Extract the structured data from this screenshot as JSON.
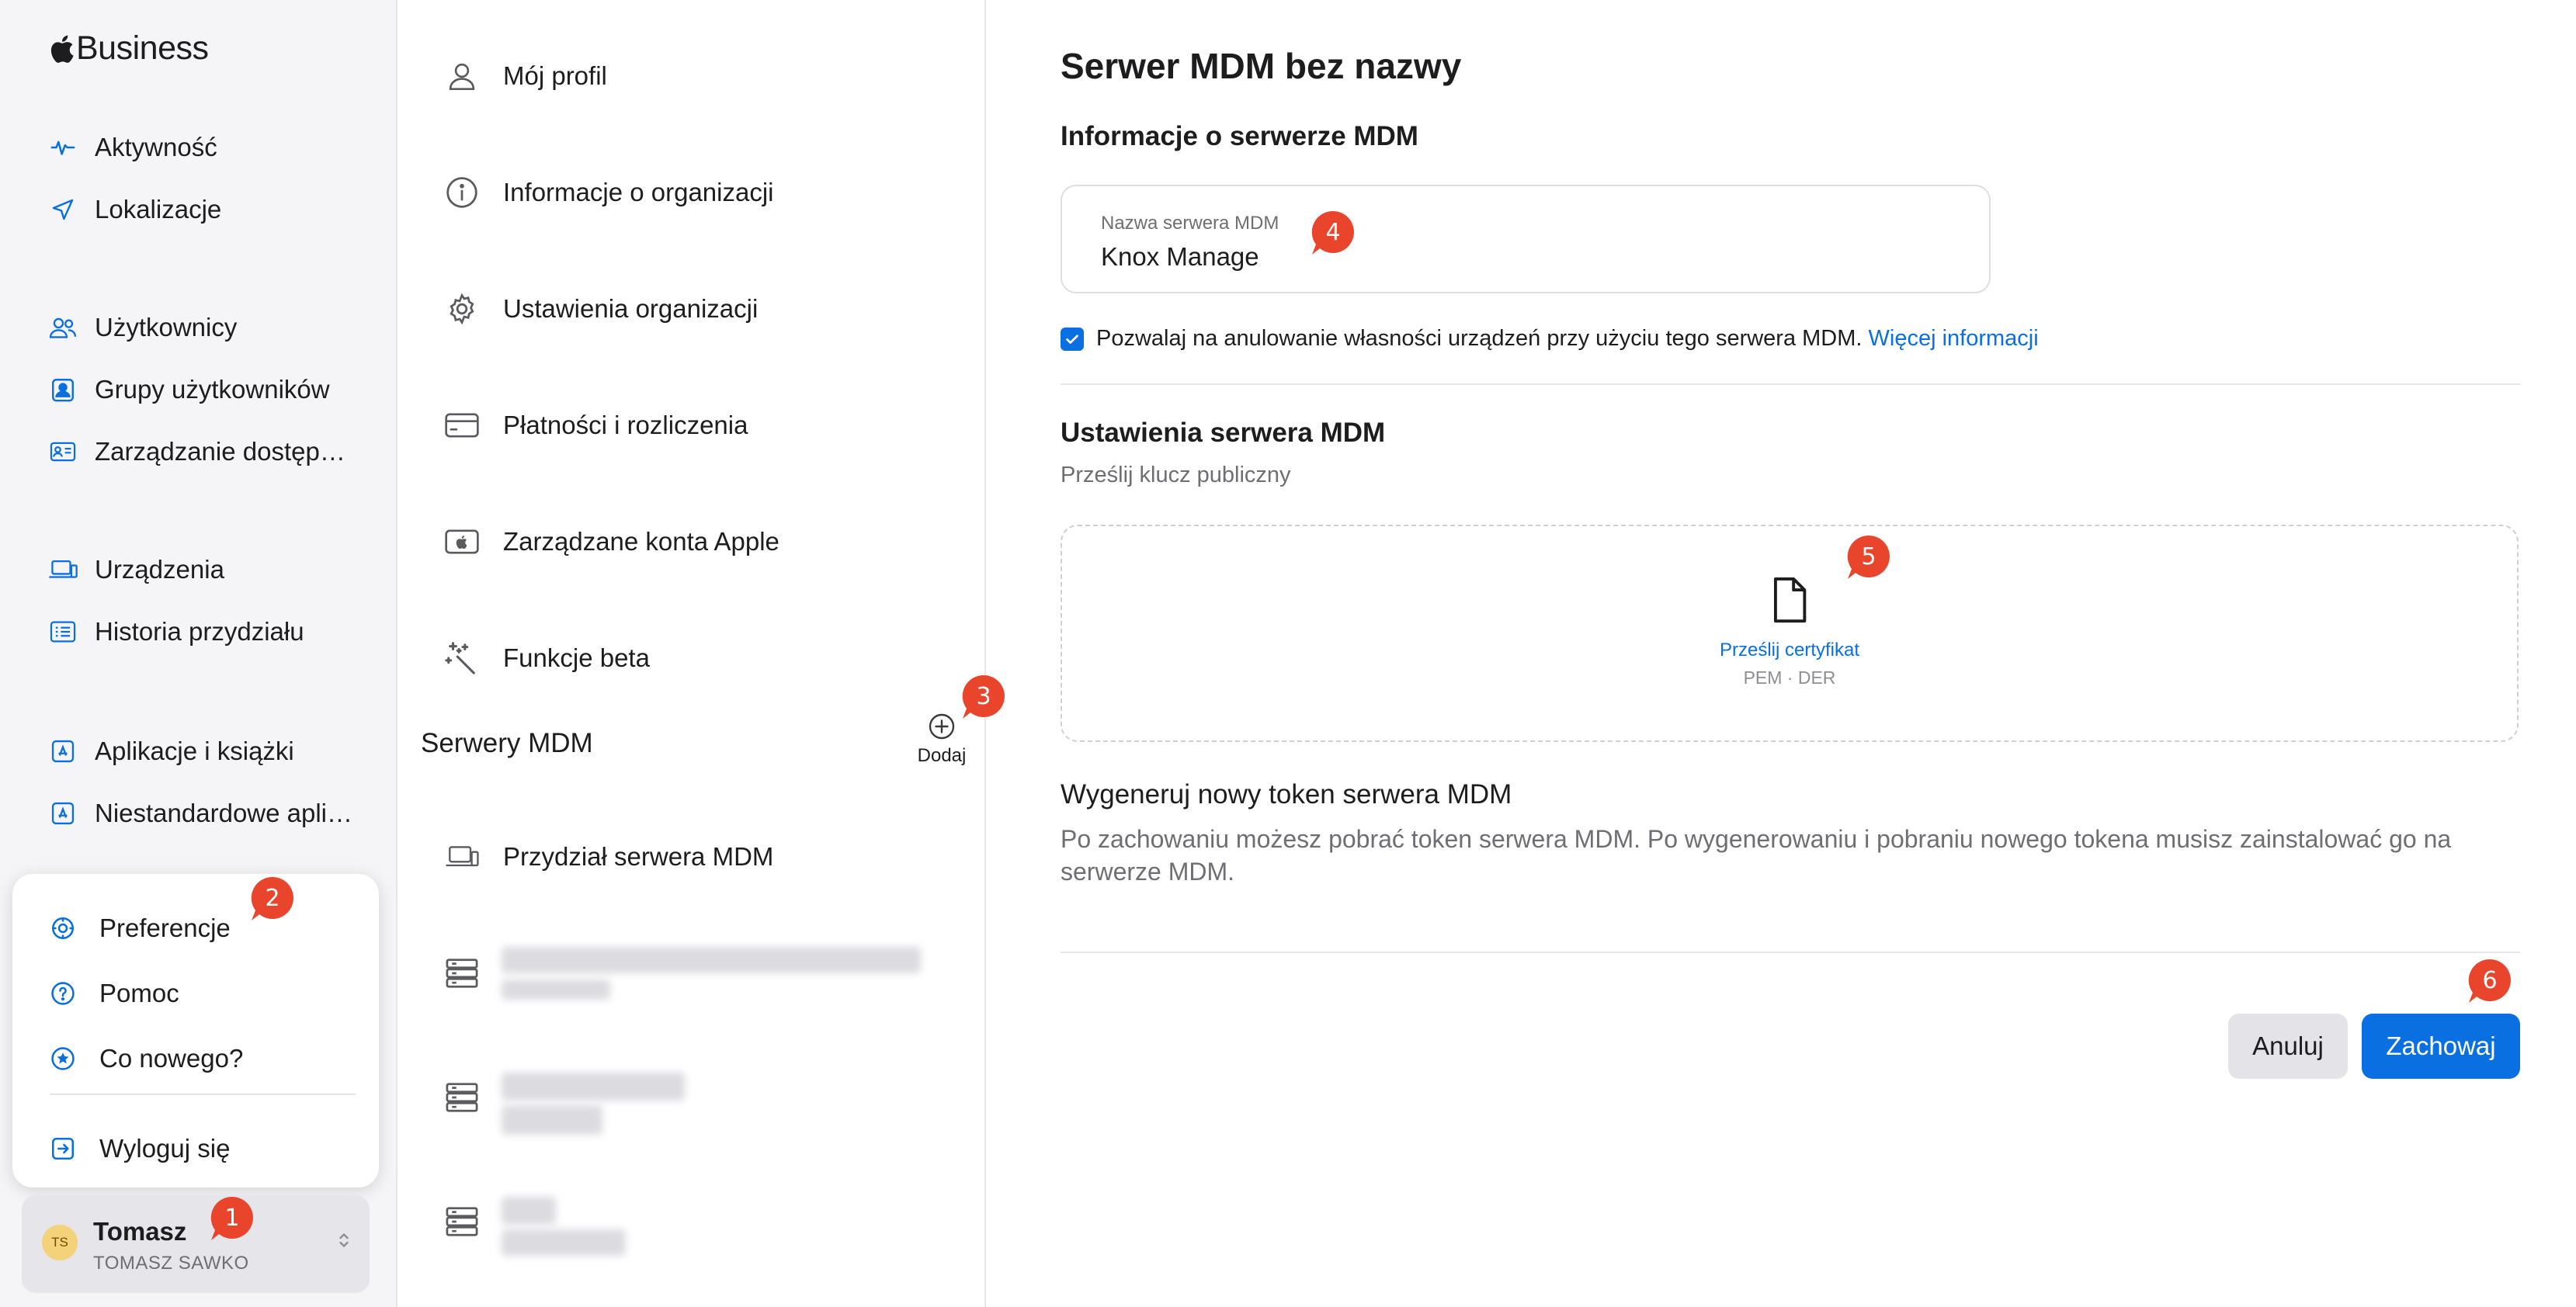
{
  "app": {
    "brand": "Business"
  },
  "sidebar": {
    "items": [
      {
        "label": "Aktywność",
        "icon": "activity-icon"
      },
      {
        "label": "Lokalizacje",
        "icon": "location-arrow-icon"
      },
      {
        "label": "Użytkownicy",
        "icon": "users-icon"
      },
      {
        "label": "Grupy użytkowników",
        "icon": "user-group-icon"
      },
      {
        "label": "Zarządzanie dostęp…",
        "icon": "id-card-icon"
      },
      {
        "label": "Urządzenia",
        "icon": "laptop-icon"
      },
      {
        "label": "Historia przydziału",
        "icon": "list-icon"
      },
      {
        "label": "Aplikacje i książki",
        "icon": "app-store-icon"
      },
      {
        "label": "Niestandardowe apli…",
        "icon": "app-store-icon"
      }
    ]
  },
  "user_menu": {
    "items": [
      {
        "label": "Preferencje",
        "icon": "gear-icon"
      },
      {
        "label": "Pomoc",
        "icon": "help-icon"
      },
      {
        "label": "Co nowego?",
        "icon": "star-icon"
      },
      {
        "label": "Wyloguj się",
        "icon": "sign-out-icon"
      }
    ]
  },
  "user": {
    "initials": "TS",
    "name": "Tomasz",
    "full_name": "TOMASZ SAWKO"
  },
  "settings_nav": {
    "items": [
      {
        "label": "Mój profil",
        "icon": "person-icon"
      },
      {
        "label": "Informacje o organizacji",
        "icon": "info-icon"
      },
      {
        "label": "Ustawienia organizacji",
        "icon": "gear-icon"
      },
      {
        "label": "Płatności i rozliczenia",
        "icon": "credit-card-icon"
      },
      {
        "label": "Zarządzane konta Apple",
        "icon": "apple-account-icon"
      },
      {
        "label": "Funkcje beta",
        "icon": "magic-wand-icon"
      }
    ],
    "mdm_section_title": "Serwery MDM",
    "add_label": "Dodaj",
    "mdm_assignment_label": "Przydział serwera MDM"
  },
  "main": {
    "title": "Serwer MDM bez nazwy",
    "info_section_title": "Informacje o serwerze MDM",
    "server_name_label": "Nazwa serwera MDM",
    "server_name_value": "Knox Manage",
    "allow_release_checked": true,
    "allow_release_text": "Pozwalaj na anulowanie własności urządzeń przy użyciu tego serwera MDM.",
    "more_info_link": "Więcej informacji",
    "settings_section_title": "Ustawienia serwera MDM",
    "upload_key_hint": "Prześlij klucz publiczny",
    "upload_cert_link": "Prześlij certyfikat",
    "upload_formats": "PEM · DER",
    "token_section_title": "Wygeneruj nowy token serwera MDM",
    "token_description": "Po zachowaniu możesz pobrać token serwera MDM. Po wygenerowaniu i pobraniu nowego tokena musisz zainstalować go na serwerze MDM.",
    "cancel_label": "Anuluj",
    "save_label": "Zachowaj"
  },
  "annotations": [
    "1",
    "2",
    "3",
    "4",
    "5",
    "6"
  ],
  "colors": {
    "accent": "#0a6fe0",
    "marker": "#e8452c",
    "sidebar_bg": "#f5f5f7"
  }
}
